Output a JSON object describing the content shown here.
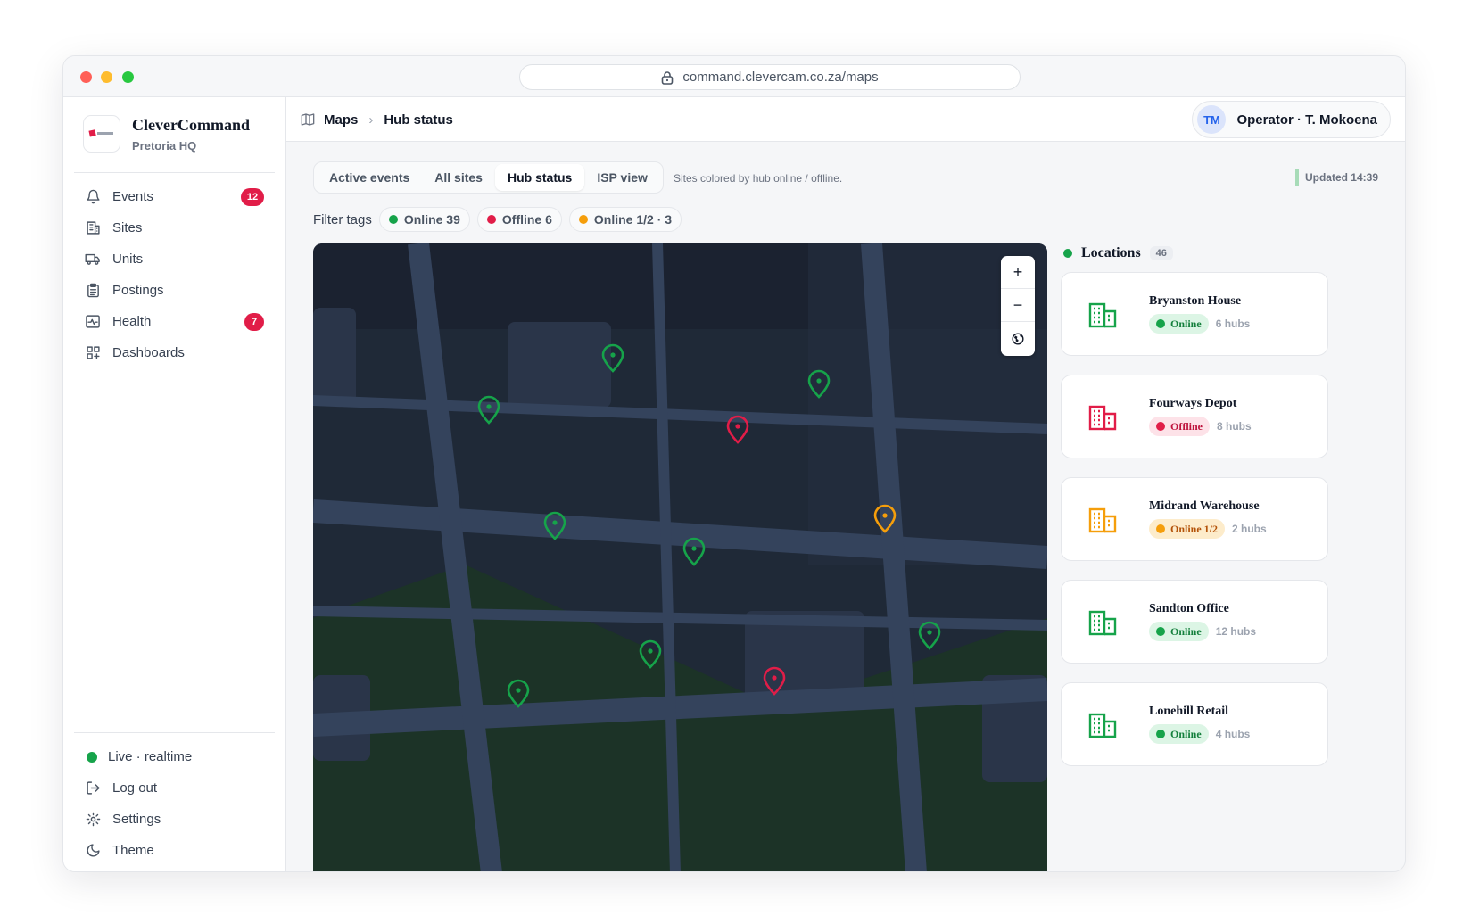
{
  "browser": {
    "url": "command.clevercam.co.za/maps"
  },
  "brand": {
    "name": "CleverCommand",
    "subtitle": "Pretoria HQ"
  },
  "nav": [
    {
      "label": "Events",
      "icon": "bell-icon",
      "badge": "12"
    },
    {
      "label": "Sites",
      "icon": "building-icon"
    },
    {
      "label": "Units",
      "icon": "truck-icon"
    },
    {
      "label": "Postings",
      "icon": "clipboard-icon"
    },
    {
      "label": "Health",
      "icon": "activity-icon",
      "badge": "7"
    },
    {
      "label": "Dashboards",
      "icon": "dashboard-icon"
    }
  ],
  "footer": {
    "live": "Live · realtime",
    "logout": "Log out",
    "settings": "Settings",
    "theme": "Theme"
  },
  "breadcrumb": {
    "root": "Maps",
    "current": "Hub status"
  },
  "operator": {
    "initials": "TM",
    "label": "Operator · T. Mokoena"
  },
  "tabs": [
    "Active events",
    "All sites",
    "Hub status",
    "ISP view"
  ],
  "active_tab": "Hub status",
  "tabs_note": "Sites colored by hub online / offline.",
  "updated": "Updated 14:39",
  "filters": {
    "label": "Filter tags",
    "chips": [
      {
        "label": "Online 39",
        "color": "#16a34a"
      },
      {
        "label": "Offline 6",
        "color": "#e11d48"
      },
      {
        "label": "Online 1/2 · 3",
        "color": "#f59e0b"
      }
    ]
  },
  "map": {
    "colors": {
      "online": "#16a34a",
      "offline": "#e11d48",
      "partial": "#f59e0b"
    },
    "zoom_controls": [
      "+",
      "−",
      "globe-icon"
    ]
  },
  "locations": {
    "title": "Locations",
    "count": "46",
    "items": [
      {
        "name": "Bryanston House",
        "status": "Online",
        "state": "online",
        "hubs": "6 hubs"
      },
      {
        "name": "Fourways Depot",
        "status": "Offline",
        "state": "offline",
        "hubs": "8 hubs"
      },
      {
        "name": "Midrand Warehouse",
        "status": "Online 1/2",
        "state": "partial",
        "hubs": "2 hubs"
      },
      {
        "name": "Sandton Office",
        "status": "Online",
        "state": "online",
        "hubs": "12 hubs"
      },
      {
        "name": "Lonehill Retail",
        "status": "Online",
        "state": "online",
        "hubs": "4 hubs"
      }
    ]
  }
}
